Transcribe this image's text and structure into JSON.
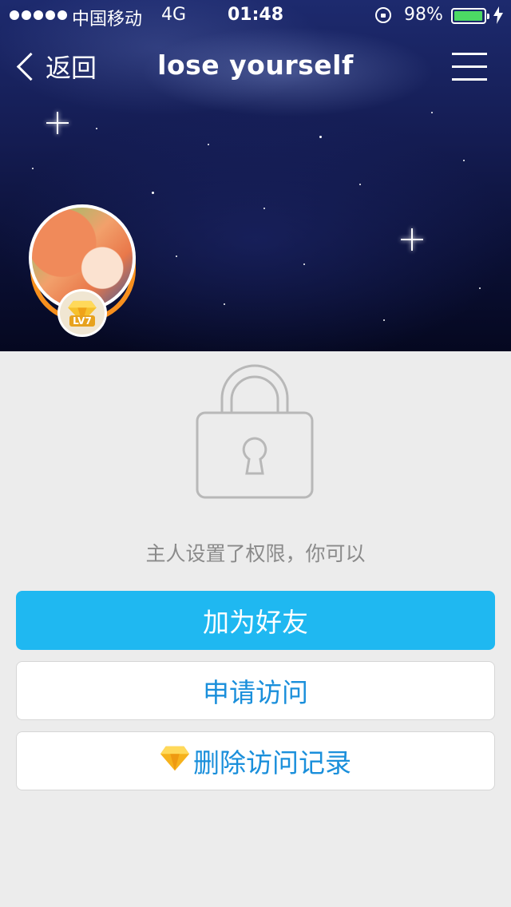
{
  "status_bar": {
    "carrier": "中国移动",
    "network": "4G",
    "time": "01:48",
    "battery_percent": "98%",
    "battery_level": 0.98
  },
  "nav": {
    "back_label": "返回",
    "title": "lose yourself"
  },
  "profile": {
    "level_badge": "LV7"
  },
  "permission": {
    "hint": "主人设置了权限，你可以"
  },
  "actions": {
    "add_friend": "加为好友",
    "request_visit": "申请访问",
    "delete_visit_records": "删除访问记录"
  },
  "colors": {
    "primary_button": "#1fb8f1",
    "link_text": "#1a8fdb",
    "background": "#ececec",
    "battery": "#4cd964"
  }
}
